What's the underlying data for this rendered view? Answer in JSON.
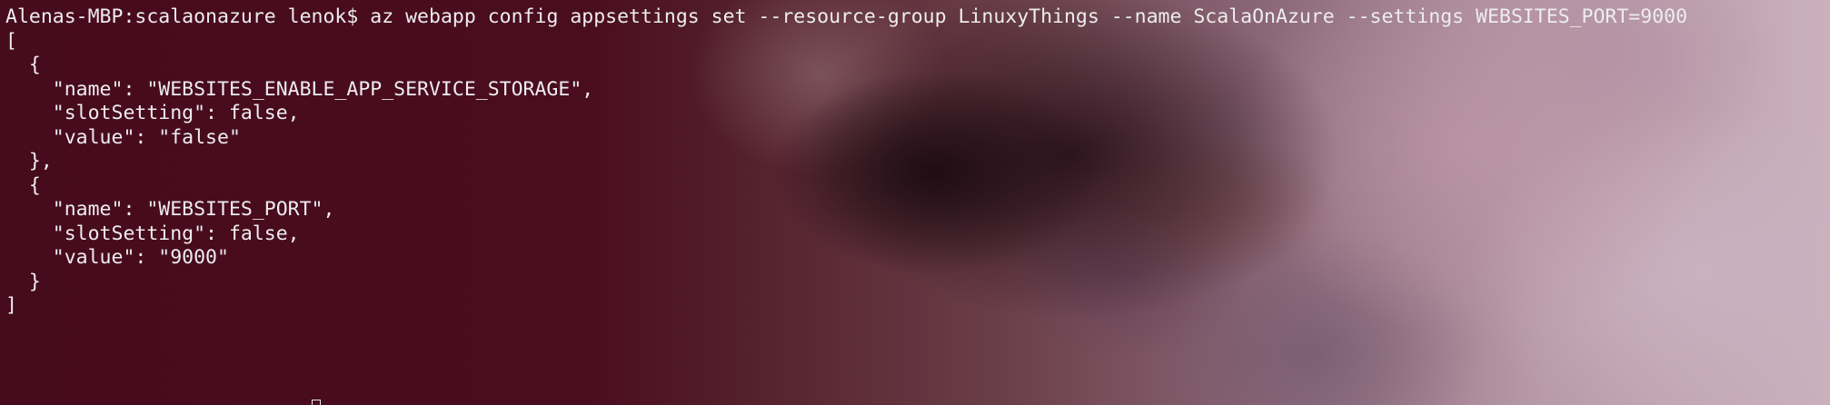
{
  "terminal": {
    "prompt": "Alenas-MBP:scalaonazure lenok$ ",
    "command": "az webapp config appsettings set --resource-group LinuxyThings --name ScalaOnAzure --settings WEBSITES_PORT=9000",
    "output_lines": [
      "[",
      "  {",
      "    \"name\": \"WEBSITES_ENABLE_APP_SERVICE_STORAGE\",",
      "    \"slotSetting\": false,",
      "    \"value\": \"false\"",
      "  },",
      "  {",
      "    \"name\": \"WEBSITES_PORT\",",
      "    \"slotSetting\": false,",
      "    \"value\": \"9000\"",
      "  }",
      "]"
    ]
  },
  "colors": {
    "text": "#ededed",
    "background_left": "#470b1e",
    "background_right": "#cab0bc"
  }
}
